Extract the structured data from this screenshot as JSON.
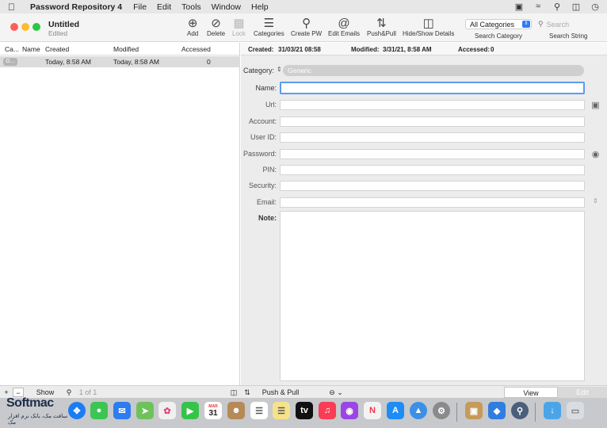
{
  "menubar": {
    "app_name": "Password Repository 4",
    "items": [
      "File",
      "Edit",
      "Tools",
      "Window",
      "Help"
    ]
  },
  "window": {
    "title": "Untitled",
    "subtitle": "Edited"
  },
  "toolbar": {
    "add": "Add",
    "delete": "Delete",
    "lock": "Lock",
    "categories": "Categories",
    "create_pw": "Create PW",
    "edit_emails": "Edit Emails",
    "push_pull": "Push&Pull",
    "hide_show": "Hide/Show Details",
    "category_select": "All Categories",
    "category_caption": "Search Category",
    "search_placeholder": "Search",
    "search_caption": "Search String"
  },
  "list": {
    "columns": [
      "Ca...",
      "Name",
      "Created",
      "Modified",
      "Accessed"
    ],
    "rows": [
      {
        "category": "G...",
        "name": "",
        "created": "Today, 8:58 AM",
        "modified": "Today, 8:58 AM",
        "accessed": "0"
      }
    ]
  },
  "detail": {
    "created_label": "Created:",
    "created_value": "31/03/21 08:58",
    "modified_label": "Modified:",
    "modified_value": "3/31/21, 8:58 AM",
    "accessed_label": "Accessed:",
    "accessed_value": "0",
    "category_label": "Category:",
    "category_value": "Generic",
    "fields": {
      "name": "Name:",
      "url": "Url:",
      "account": "Account:",
      "user_id": "User ID:",
      "password": "Password:",
      "pin": "PIN:",
      "security": "Security:",
      "email": "Email:",
      "note": "Note:"
    }
  },
  "bottom": {
    "add": "+",
    "remove": "−",
    "show": "Show",
    "page": "1 of 1",
    "push_pull": "Push & Pull",
    "view": "View",
    "edit": "Edit"
  },
  "dock": {
    "calendar_month": "MAR",
    "calendar_day": "31"
  },
  "watermark": {
    "brand": "Softmac",
    "sub": "سافت مک، بانک نرم افزار مک"
  }
}
